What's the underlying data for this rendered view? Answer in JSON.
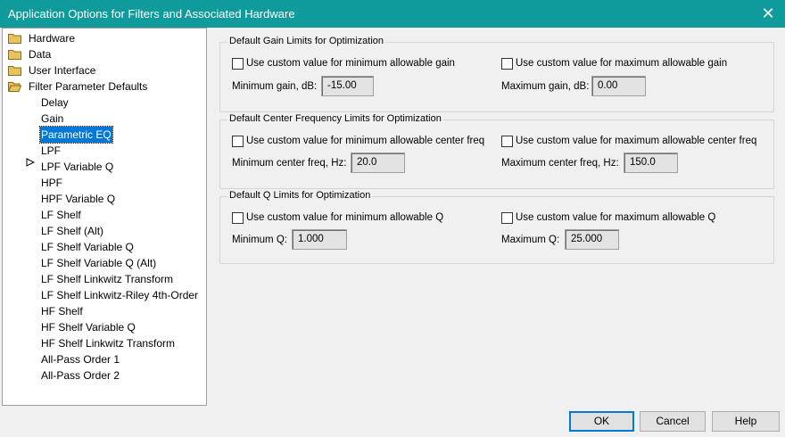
{
  "window": {
    "title": "Application Options for Filters and Associated Hardware"
  },
  "tree": {
    "folders": [
      "Hardware",
      "Data",
      "User Interface",
      "Filter Parameter Defaults"
    ],
    "children": [
      "Delay",
      "Gain",
      "Parametric EQ",
      "LPF",
      "LPF Variable Q",
      "HPF",
      "HPF Variable Q",
      "LF Shelf",
      "LF Shelf (Alt)",
      "LF Shelf Variable Q",
      "LF Shelf Variable Q (Alt)",
      "LF Shelf Linkwitz Transform",
      "LF Shelf Linkwitz-Riley 4th-Order",
      "HF Shelf",
      "HF Shelf Variable Q",
      "HF Shelf Linkwitz Transform",
      "All-Pass Order 1",
      "All-Pass Order 2"
    ],
    "selected": "Parametric EQ"
  },
  "groups": {
    "gain": {
      "title": "Default Gain Limits for Optimization",
      "min_check": "Use custom value for minimum allowable gain",
      "max_check": "Use custom value for maximum allowable gain",
      "min_label": "Minimum gain, dB:",
      "min_value": "-15.00",
      "max_label": "Maximum gain, dB:",
      "max_value": "0.00"
    },
    "freq": {
      "title": "Default Center Frequency Limits for Optimization",
      "min_check": "Use custom value for minimum allowable center freq",
      "max_check": "Use custom value for maximum allowable center freq",
      "min_label": "Minimum center freq, Hz:",
      "min_value": "20.0",
      "max_label": "Maximum center freq, Hz:",
      "max_value": "150.0"
    },
    "q": {
      "title": "Default Q Limits for Optimization",
      "min_check": "Use custom value for minimum allowable Q",
      "max_check": "Use custom value for maximum allowable Q",
      "min_label": "Minimum Q:",
      "min_value": "1.000",
      "max_label": "Maximum Q:",
      "max_value": "25.000"
    }
  },
  "buttons": {
    "ok": "OK",
    "cancel": "Cancel",
    "help": "Help"
  },
  "colors": {
    "titlebar": "#0f9b9b",
    "selection": "#0078d7",
    "folder": "#e8c25a"
  }
}
